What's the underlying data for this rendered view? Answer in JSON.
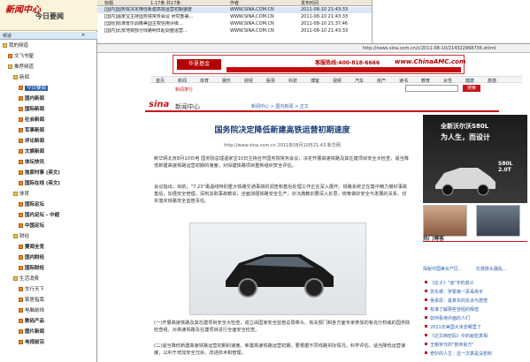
{
  "left_pane": {
    "logo_text": "新闻中心",
    "logo_sub": "今日要闻",
    "toolbar_left": "频道",
    "tree": [
      {
        "label": "我的频道",
        "level": 0,
        "icon": "folder-icon"
      },
      {
        "label": "文飞书屋",
        "level": 1,
        "icon": "feed-icon"
      },
      {
        "label": "推荐频道",
        "level": 1,
        "icon": "folder-icon"
      },
      {
        "label": "新闻",
        "level": 2,
        "icon": "folder-icon"
      },
      {
        "label": "今日要闻",
        "level": 3,
        "icon": "feed-icon",
        "selected": true
      },
      {
        "label": "国内新闻",
        "level": 3,
        "icon": "feed-icon",
        "bold": true
      },
      {
        "label": "国际新闻",
        "level": 3,
        "icon": "feed-icon",
        "bold": true
      },
      {
        "label": "社会新闻",
        "level": 3,
        "icon": "feed-icon",
        "bold": true
      },
      {
        "label": "军事新闻",
        "level": 3,
        "icon": "feed-icon",
        "bold": true
      },
      {
        "label": "评论新闻",
        "level": 3,
        "icon": "feed-icon",
        "bold": true
      },
      {
        "label": "文娱新闻",
        "level": 3,
        "icon": "feed-icon",
        "bold": true
      },
      {
        "label": "体坛快讯",
        "level": 3,
        "icon": "feed-icon",
        "bold": true
      },
      {
        "label": "独家时事 (英文)",
        "level": 3,
        "icon": "feed-icon",
        "bold": true
      },
      {
        "label": "国际在线 (英文)",
        "level": 3,
        "icon": "feed-icon",
        "bold": true
      },
      {
        "label": "体育",
        "level": 2,
        "icon": "folder-icon"
      },
      {
        "label": "国际足坛",
        "level": 3,
        "icon": "feed-icon",
        "bold": true
      },
      {
        "label": "国内足坛 - 中超",
        "level": 3,
        "icon": "feed-icon",
        "bold": true
      },
      {
        "label": "中国足坛",
        "level": 3,
        "icon": "feed-icon",
        "bold": true
      },
      {
        "label": "财经",
        "level": 2,
        "icon": "folder-icon"
      },
      {
        "label": "要闻全览",
        "level": 3,
        "icon": "feed-icon",
        "bold": true
      },
      {
        "label": "国内财经",
        "level": 3,
        "icon": "feed-icon",
        "bold": true
      },
      {
        "label": "国际财经",
        "level": 3,
        "icon": "feed-icon",
        "bold": true
      },
      {
        "label": "生活消费",
        "level": 2,
        "icon": "folder-icon"
      },
      {
        "label": "车行天下",
        "level": 3,
        "icon": "feed-icon"
      },
      {
        "label": "家居指南",
        "level": 3,
        "icon": "feed-icon"
      },
      {
        "label": "电脑前线",
        "level": 3,
        "icon": "feed-icon"
      },
      {
        "label": "数码产品",
        "level": 3,
        "icon": "feed-icon",
        "bold": true
      },
      {
        "label": "图片新闻",
        "level": 3,
        "icon": "feed-icon",
        "bold": true
      },
      {
        "label": "电视前沿",
        "level": 3,
        "icon": "feed-icon",
        "bold": true
      }
    ]
  },
  "msg_list": {
    "headers": [
      "标题",
      "1-17条 共17条",
      "作者",
      "发布时间"
    ],
    "rows": [
      {
        "title": "[国内]国务院决定降低新建高铁运营初期速度",
        "author": "WWW.SINA.COM.CN",
        "time": "2011-08-10 21:43:33"
      },
      {
        "title": "[国内]温家宝主持国务院常务会议 研究部署...",
        "author": "WWW.SINA.COM.CN",
        "time": "2011-08-10 21:43:33"
      },
      {
        "title": "[国际]标准普尔调降美国主权信用评级...",
        "author": "WWW.SINA.COM.CN",
        "time": "2011-08-10 21:37:46"
      },
      {
        "title": "[国内]北京地铁部分线路明日起调整运营...",
        "author": "WWW.SINA.COM.CN",
        "time": "2011-08-10 21:43:33"
      }
    ]
  },
  "url_bar": {
    "url": "http://news.sina.com.cn/c/2011-08-10/214322968736.shtml"
  },
  "banner": {
    "logo": "华夏基金",
    "phone": "客服热线:400-818-6666",
    "site": "www.ChinaAMC.com"
  },
  "nav": {
    "links": [
      "首页",
      "新闻",
      "体育",
      "娱乐",
      "财经",
      "股票",
      "科技",
      "博客",
      "视频",
      "汽车",
      "房产",
      "读书",
      "教育",
      "女性",
      "健康",
      "旅游"
    ],
    "search_hint": "新闻排行",
    "search_btn": "搜索"
  },
  "sina": {
    "logo": "sina",
    "sub": "新闻中心",
    "crumb": "新闻中心 > 国内新闻 > 正文"
  },
  "article": {
    "headline": "国务院决定降低新建高铁运营初期速度",
    "dateline": "http://www.sina.com.cn  2011年08月10日21:43  新华网",
    "p1": "新华网北京8月10日电 国务院总理温家宝10日主持召开国务院常务会议，决定开展高速铁路及其在建项目安全大检查，适当降低新建高速铁路运营初期的速度，对拟建铁路项目重新组织安全评估。",
    "p2": "会议指出，目前，\"7·23\"甬温线特别重大铁路交通事故的调查和善后处理工作正在深入展开。铁路系统正在集中精力做好事故善后，加强安全管理，深刻汲取事故教训，全面加强铁路安全生产，对沉痛教训要深入反思，统筹做好安全与发展的关系，切实落实铁路安全监管责任。",
    "p3": "(一)开展高速铁路及其在建项目安全大检查，成立由国家安全监管总局牵头、有关部门和各方面专家参加的有充分权威的国务院检查组，对高速铁路及在建项目进行全面安全检查。",
    "p4": "(二)适当降低新建高速铁路运营初期的速度。新建高速铁路运营初期，要根据不同线路实际情况，科学评估，适当降低运营速度，以利于增加安全冗余，改进技术和管理。"
  },
  "ad": {
    "title": "全新沃尔沃S80L",
    "sub": "为人生，而设计",
    "model": "S80L 2.0T"
  },
  "hot": {
    "title": "热门博客",
    "thumb_caps": [
      "探秘中国美女产区...",
      "伦敦街头骚乱..."
    ],
    "items": [
      "《庄子》\"逍\"字的真义",
      "苏东坡：罗霍第一恶毒高手",
      "吴承恩：最真实的反派与唐僧",
      "有谁了解那些曾经的辉煌",
      "如何看待外面的人们",
      "2011年美国大米去哪里了",
      "《达文西密码》中的秘密真相",
      "王朝末代的\"救命良方\"",
      "奇妙的人生：这一次真是没想到"
    ]
  }
}
